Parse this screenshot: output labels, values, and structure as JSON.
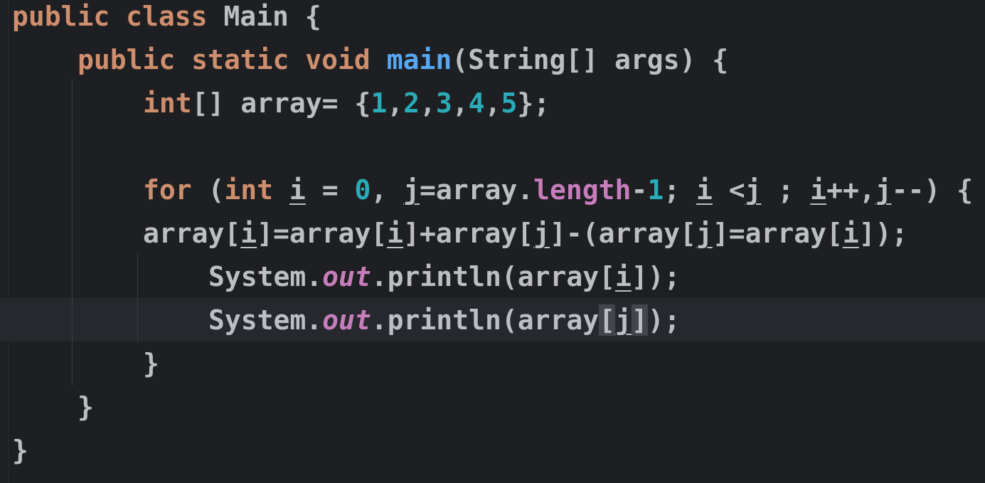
{
  "editor": {
    "language": "Java",
    "theme": "dark",
    "colors": {
      "background": "#1e1f22",
      "keyword": "#cf8e6d",
      "number": "#2aacb8",
      "method_declaration": "#56a8f5",
      "field": "#c77dbb",
      "default_text": "#bcbec4",
      "current_line": "#26282e"
    },
    "lines": [
      [
        [
          "kw",
          "public class "
        ],
        [
          "t",
          "Main {"
        ]
      ],
      [
        [
          "kw",
          "public static void "
        ],
        [
          "fn",
          "main"
        ],
        [
          "t",
          "(String[] args) {"
        ]
      ],
      [
        [
          "kw",
          "int"
        ],
        [
          "t",
          "[] array= {"
        ],
        [
          "num",
          "1"
        ],
        [
          "t",
          ","
        ],
        [
          "num",
          "2"
        ],
        [
          "t",
          ","
        ],
        [
          "num",
          "3"
        ],
        [
          "t",
          ","
        ],
        [
          "num",
          "4"
        ],
        [
          "t",
          ","
        ],
        [
          "num",
          "5"
        ],
        [
          "t",
          "};"
        ]
      ],
      [],
      [
        [
          "kw",
          "for "
        ],
        [
          "t",
          "("
        ],
        [
          "kw",
          "int "
        ],
        [
          "var",
          "i"
        ],
        [
          "t",
          " = "
        ],
        [
          "num",
          "0"
        ],
        [
          "t",
          ", "
        ],
        [
          "var",
          "j"
        ],
        [
          "t",
          "=array."
        ],
        [
          "fld",
          "length"
        ],
        [
          "t",
          "-"
        ],
        [
          "num",
          "1"
        ],
        [
          "t",
          "; "
        ],
        [
          "var",
          "i"
        ],
        [
          "t",
          " <"
        ],
        [
          "var",
          "j"
        ],
        [
          "t",
          " ; "
        ],
        [
          "var",
          "i"
        ],
        [
          "t",
          "++,"
        ],
        [
          "var",
          "j"
        ],
        [
          "t",
          "--) {"
        ]
      ],
      [
        [
          "t",
          "array["
        ],
        [
          "var",
          "i"
        ],
        [
          "t",
          "]=array["
        ],
        [
          "var",
          "i"
        ],
        [
          "t",
          "]+array["
        ],
        [
          "var",
          "j"
        ],
        [
          "t",
          "]-(array["
        ],
        [
          "var",
          "j"
        ],
        [
          "t",
          "]=array["
        ],
        [
          "var",
          "i"
        ],
        [
          "t",
          "]);"
        ]
      ],
      [
        [
          "t",
          "System."
        ],
        [
          "sfld",
          "out"
        ],
        [
          "t",
          ".println(array["
        ],
        [
          "var",
          "i"
        ],
        [
          "t",
          "]);"
        ]
      ],
      [
        [
          "t",
          "System."
        ],
        [
          "sfld",
          "out"
        ],
        [
          "t",
          ".println(array"
        ],
        [
          "brm",
          "["
        ],
        [
          "var",
          "j"
        ],
        [
          "brm",
          "]"
        ],
        [
          "t",
          ");"
        ]
      ],
      [
        [
          "t",
          "}"
        ]
      ],
      [
        [
          "t",
          "}"
        ]
      ],
      [
        [
          "t",
          "}"
        ]
      ]
    ]
  }
}
